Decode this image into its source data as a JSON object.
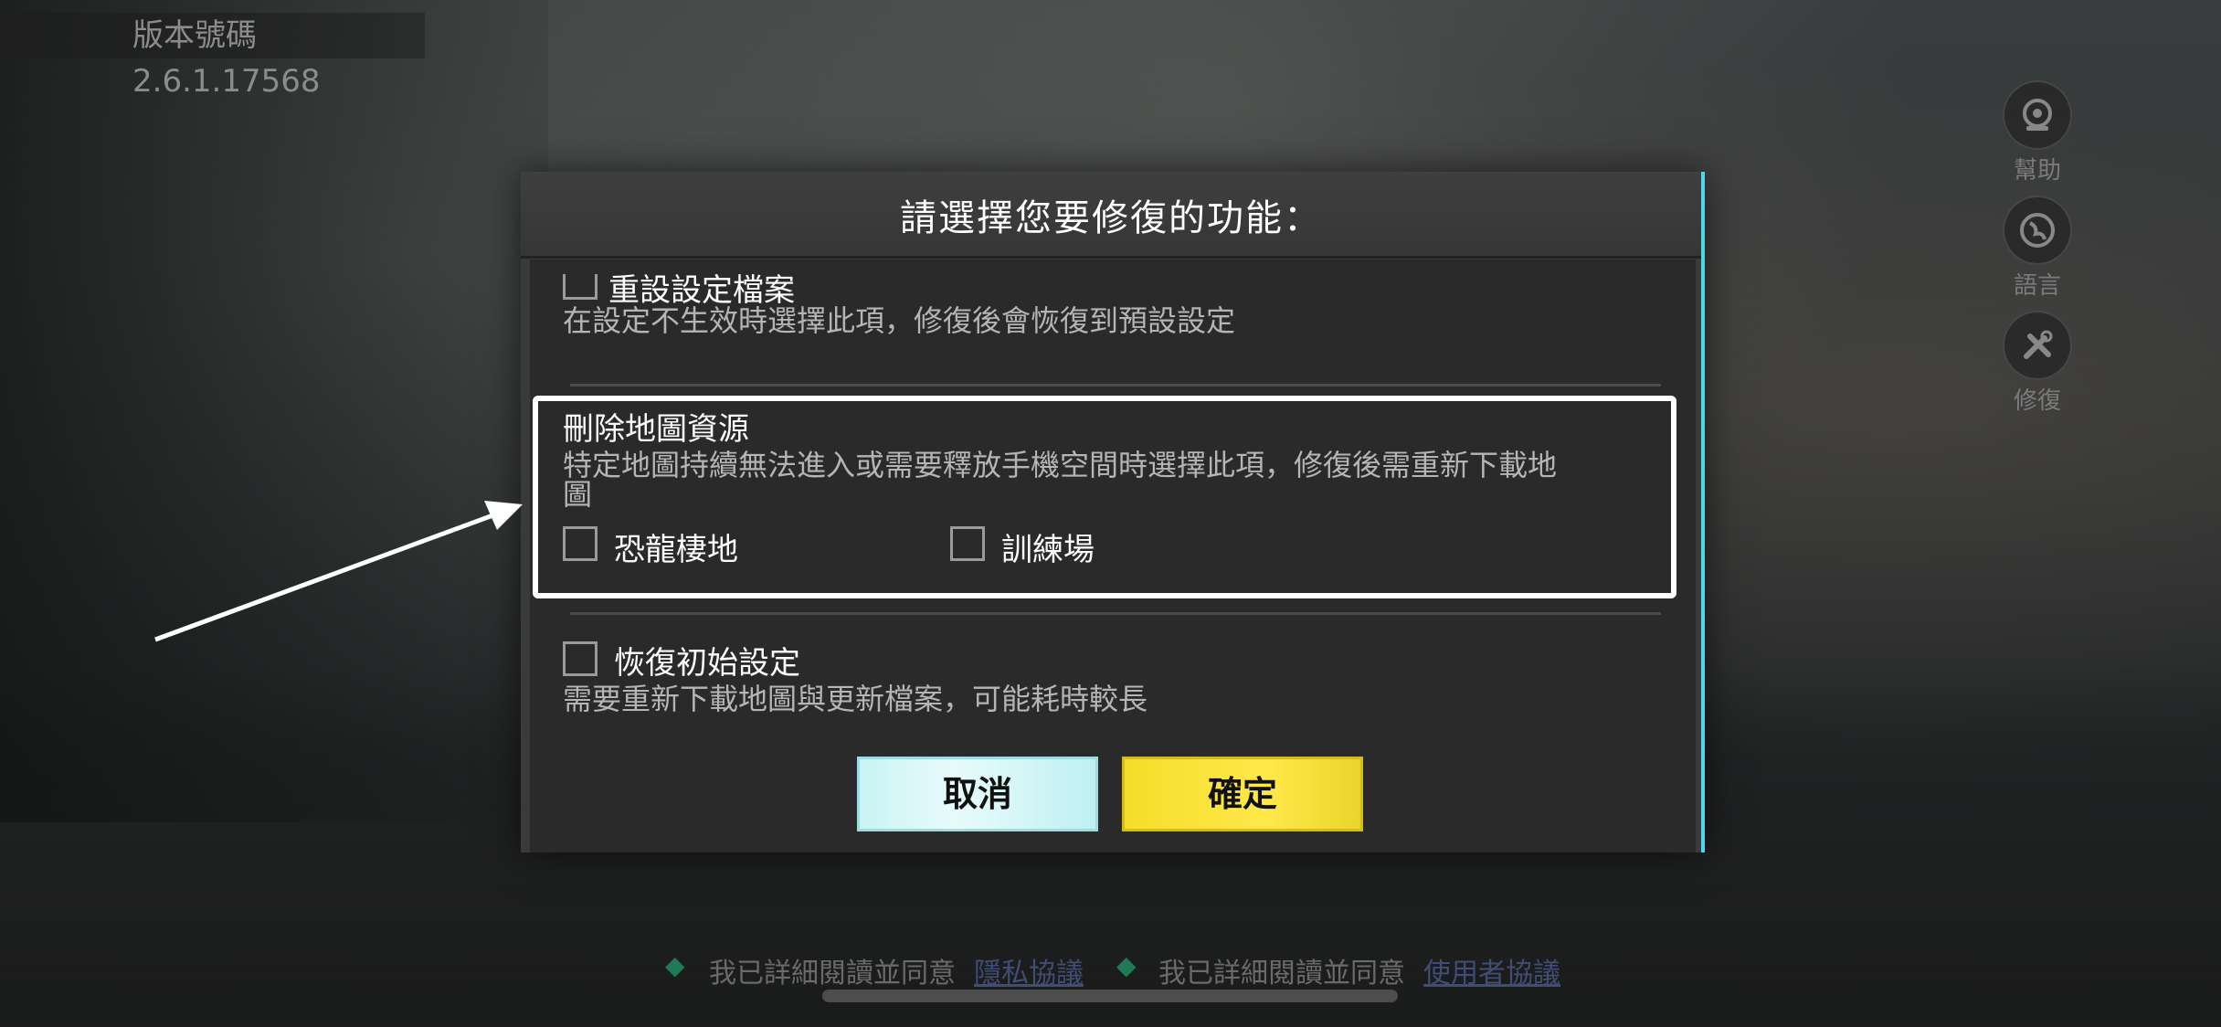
{
  "version": {
    "text": "版本號碼2.6.1.17568"
  },
  "side_menu": [
    {
      "label": "幫助",
      "icon": "help-icon"
    },
    {
      "label": "語言",
      "icon": "globe-icon"
    },
    {
      "label": "修復",
      "icon": "repair-icon"
    }
  ],
  "dialog": {
    "title": "請選擇您要修復的功能：",
    "options": [
      {
        "title": "重設設定檔案",
        "desc": "在設定不生效時選擇此項，修復後會恢復到預設設定",
        "checked": false
      },
      {
        "title": "刪除地圖資源",
        "desc_line1": "特定地圖持續無法進入或需要釋放手機空間時選擇此項，修復後需重新下載地",
        "desc_line2": "圖",
        "sub_options": [
          {
            "label": "恐龍棲地",
            "checked": false
          },
          {
            "label": "訓練場",
            "checked": false
          }
        ]
      },
      {
        "title": "恢復初始設定",
        "desc": "需要重新下載地圖與更新檔案，可能耗時較長",
        "checked": false
      }
    ],
    "cancel_label": "取消",
    "confirm_label": "確定"
  },
  "footer": {
    "agree_prefix_1": "我已詳細閱讀並同意",
    "privacy_link": "隱私協議",
    "agree_prefix_2": "我已詳細閱讀並同意",
    "user_link": "使用者協議"
  },
  "colors": {
    "dialog_bg": "#2a2a2b",
    "confirm": "#ffe84a",
    "cancel": "#c9f3f4",
    "accent_edge": "#4fd6e8"
  }
}
